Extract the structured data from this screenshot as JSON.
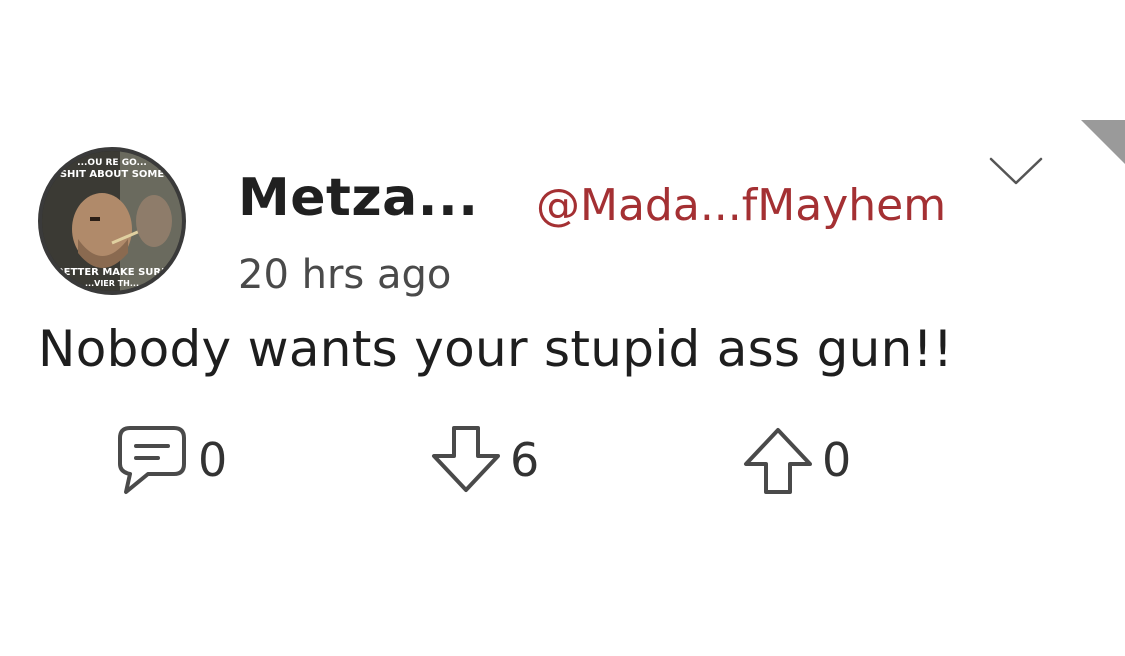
{
  "post": {
    "author_name": "Metza...",
    "author_handle": "@Mada...fMayhem",
    "timestamp": "20 hrs ago",
    "body": "Nobody wants your stupid ass gun!!",
    "avatar": {
      "meme_text_top_1": "...OU RE GO...",
      "meme_text_top_2": "SHIT ABOUT SOME",
      "meme_text_bottom_1": "BETTER MAKE SURE",
      "meme_text_bottom_2": "...VIER TH..."
    }
  },
  "actions": {
    "comments_count": "0",
    "downvotes_count": "6",
    "upvotes_count": "0"
  },
  "icons": {
    "comment": "comment-bubble-icon",
    "downvote": "arrow-down-icon",
    "upvote": "arrow-up-icon",
    "menu": "chevron-down-icon"
  },
  "colors": {
    "handle": "#a43033",
    "text": "#1e1e1e",
    "icon": "#4a4a4a"
  }
}
